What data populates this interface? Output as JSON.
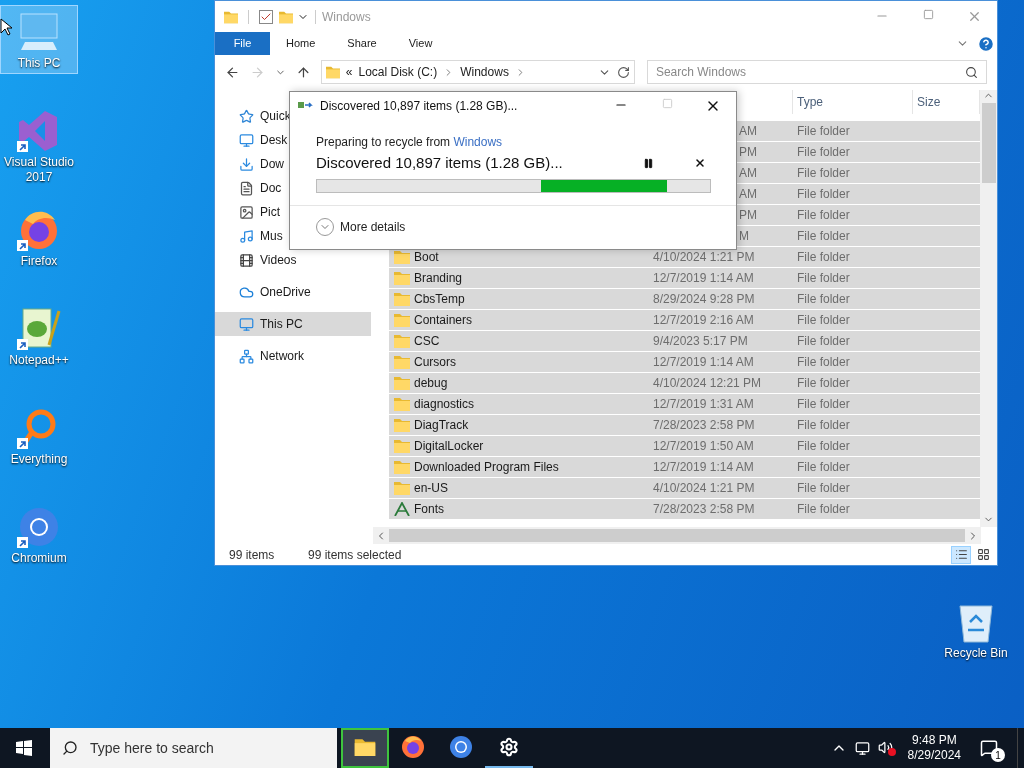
{
  "desktop": {
    "icons": [
      {
        "label": "This PC",
        "kind": "pc",
        "selected": true
      },
      {
        "label": "Visual Studio 2017",
        "kind": "vs",
        "selected": false
      },
      {
        "label": "Firefox",
        "kind": "firefox",
        "selected": false
      },
      {
        "label": "Notepad++",
        "kind": "notepad",
        "selected": false
      },
      {
        "label": "Everything",
        "kind": "everything",
        "selected": false
      },
      {
        "label": "Chromium",
        "kind": "chromium",
        "selected": false
      }
    ],
    "recycle_bin": {
      "label": "Recycle Bin"
    }
  },
  "explorer": {
    "title": "Windows",
    "ribbon_tabs": [
      {
        "label": "File",
        "selected": true
      },
      {
        "label": "Home",
        "selected": false
      },
      {
        "label": "Share",
        "selected": false
      },
      {
        "label": "View",
        "selected": false
      }
    ],
    "address": {
      "overflow": "«",
      "crumbs": [
        "Local Disk (C:)",
        "Windows"
      ]
    },
    "search": {
      "placeholder": "Search Windows"
    },
    "sidebar": {
      "sections": [
        {
          "items": [
            {
              "label": "Quick",
              "kind": "star",
              "selected": false
            },
            {
              "label": "Desk",
              "kind": "desktop",
              "selected": false
            },
            {
              "label": "Dow",
              "kind": "download",
              "selected": false
            },
            {
              "label": "Doc",
              "kind": "document",
              "selected": false
            },
            {
              "label": "Pict",
              "kind": "pictures",
              "selected": false
            },
            {
              "label": "Mus",
              "kind": "music",
              "selected": false
            },
            {
              "label": "Videos",
              "kind": "videos",
              "selected": false
            }
          ]
        },
        {
          "items": [
            {
              "label": "OneDrive",
              "kind": "cloud",
              "selected": false
            }
          ]
        },
        {
          "items": [
            {
              "label": "This PC",
              "kind": "pc",
              "selected": true
            }
          ]
        },
        {
          "items": [
            {
              "label": "Network",
              "kind": "network",
              "selected": false
            }
          ]
        }
      ]
    },
    "columns": [
      {
        "label": "Type"
      },
      {
        "label": "Size"
      }
    ],
    "rows": [
      {
        "date": "AM",
        "type": "File folder",
        "selected": true
      },
      {
        "date": "PM",
        "type": "File folder",
        "selected": true
      },
      {
        "date": "AM",
        "type": "File folder",
        "selected": true
      },
      {
        "date": "AM",
        "type": "File folder",
        "selected": true
      },
      {
        "date": "PM",
        "type": "File folder",
        "selected": true
      },
      {
        "date": "M",
        "type": "File folder",
        "selected": true
      },
      {
        "name": "Boot",
        "kind": "folder",
        "date": "4/10/2024 1:21 PM",
        "type": "File folder",
        "selected": true
      },
      {
        "name": "Branding",
        "kind": "folder",
        "date": "12/7/2019 1:14 AM",
        "type": "File folder",
        "selected": true
      },
      {
        "name": "CbsTemp",
        "kind": "folder",
        "date": "8/29/2024 9:28 PM",
        "type": "File folder",
        "selected": true
      },
      {
        "name": "Containers",
        "kind": "folder",
        "date": "12/7/2019 2:16 AM",
        "type": "File folder",
        "selected": true
      },
      {
        "name": "CSC",
        "kind": "folder",
        "date": "9/4/2023 5:17 PM",
        "type": "File folder",
        "selected": true
      },
      {
        "name": "Cursors",
        "kind": "folder",
        "date": "12/7/2019 1:14 AM",
        "type": "File folder",
        "selected": true
      },
      {
        "name": "debug",
        "kind": "folder",
        "date": "4/10/2024 12:21 PM",
        "type": "File folder",
        "selected": true
      },
      {
        "name": "diagnostics",
        "kind": "folder",
        "date": "12/7/2019 1:31 AM",
        "type": "File folder",
        "selected": true
      },
      {
        "name": "DiagTrack",
        "kind": "folder",
        "date": "7/28/2023 2:58 PM",
        "type": "File folder",
        "selected": true
      },
      {
        "name": "DigitalLocker",
        "kind": "folder",
        "date": "12/7/2019 1:50 AM",
        "type": "File folder",
        "selected": true
      },
      {
        "name": "Downloaded Program Files",
        "kind": "folder",
        "date": "12/7/2019 1:14 AM",
        "type": "File folder",
        "selected": true
      },
      {
        "name": "en-US",
        "kind": "folder",
        "date": "4/10/2024 1:21 PM",
        "type": "File folder",
        "selected": true
      },
      {
        "name": "Fonts",
        "kind": "fonts",
        "date": "7/28/2023 2:58 PM",
        "type": "File folder",
        "selected": true
      }
    ],
    "status": {
      "count": "99 items",
      "selection": "99 items selected"
    },
    "views": [
      {
        "kind": "details",
        "selected": true
      },
      {
        "kind": "large",
        "selected": false
      }
    ]
  },
  "dialog": {
    "title": "Discovered 10,897 items (1.28 GB)...",
    "prefix": "Preparing to recycle from",
    "source": "Windows",
    "status": "Discovered 10,897 items (1.28 GB)...",
    "progress": {
      "kind": "marquee"
    },
    "more": {
      "label": "More details",
      "expanded": false
    }
  },
  "taskbar": {
    "search": {
      "placeholder": "Type here to search"
    },
    "apps": [
      {
        "kind": "explorer",
        "selected": true,
        "running": true
      },
      {
        "kind": "firefox",
        "selected": false,
        "running": false
      },
      {
        "kind": "chromium",
        "selected": false,
        "running": false
      },
      {
        "kind": "settings",
        "selected": false,
        "running": true
      }
    ],
    "volume": {
      "muted": true
    },
    "time": "9:48 PM",
    "date": "8/29/2024",
    "notifications": "1"
  }
}
